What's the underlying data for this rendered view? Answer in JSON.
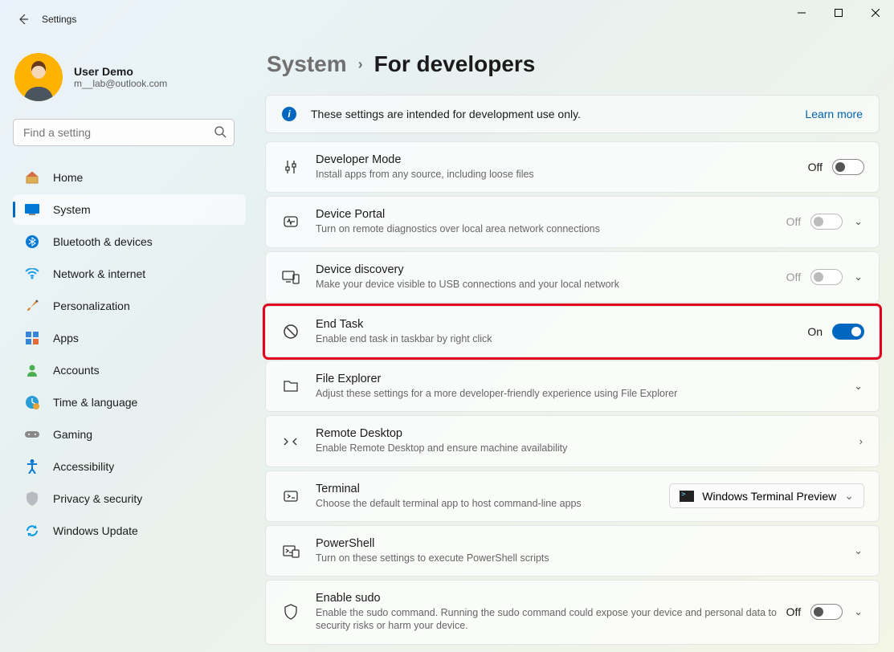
{
  "app_title": "Settings",
  "profile": {
    "name": "User Demo",
    "email": "m__lab@outlook.com"
  },
  "search": {
    "placeholder": "Find a setting"
  },
  "nav": [
    {
      "id": "home",
      "label": "Home"
    },
    {
      "id": "system",
      "label": "System"
    },
    {
      "id": "bluetooth",
      "label": "Bluetooth & devices"
    },
    {
      "id": "network",
      "label": "Network & internet"
    },
    {
      "id": "personalization",
      "label": "Personalization"
    },
    {
      "id": "apps",
      "label": "Apps"
    },
    {
      "id": "accounts",
      "label": "Accounts"
    },
    {
      "id": "time",
      "label": "Time & language"
    },
    {
      "id": "gaming",
      "label": "Gaming"
    },
    {
      "id": "accessibility",
      "label": "Accessibility"
    },
    {
      "id": "privacy",
      "label": "Privacy & security"
    },
    {
      "id": "update",
      "label": "Windows Update"
    }
  ],
  "breadcrumb": {
    "lvl1": "System",
    "sep": "›",
    "lvl2": "For developers"
  },
  "banner": {
    "message": "These settings are intended for development use only.",
    "link": "Learn more"
  },
  "cards": {
    "devmode": {
      "title": "Developer Mode",
      "desc": "Install apps from any source, including loose files",
      "state": "Off"
    },
    "portal": {
      "title": "Device Portal",
      "desc": "Turn on remote diagnostics over local area network connections",
      "state": "Off"
    },
    "discovery": {
      "title": "Device discovery",
      "desc": "Make your device visible to USB connections and your local network",
      "state": "Off"
    },
    "endtask": {
      "title": "End Task",
      "desc": "Enable end task in taskbar by right click",
      "state": "On"
    },
    "explorer": {
      "title": "File Explorer",
      "desc": "Adjust these settings for a more developer-friendly experience using File Explorer"
    },
    "remote": {
      "title": "Remote Desktop",
      "desc": "Enable Remote Desktop and ensure machine availability"
    },
    "terminal": {
      "title": "Terminal",
      "desc": "Choose the default terminal app to host command-line apps",
      "select": "Windows Terminal Preview"
    },
    "powershell": {
      "title": "PowerShell",
      "desc": "Turn on these settings to execute PowerShell scripts"
    },
    "sudo": {
      "title": "Enable sudo",
      "desc": "Enable the sudo command. Running the sudo command could expose your device and personal data to security risks or harm your device.",
      "state": "Off"
    }
  }
}
